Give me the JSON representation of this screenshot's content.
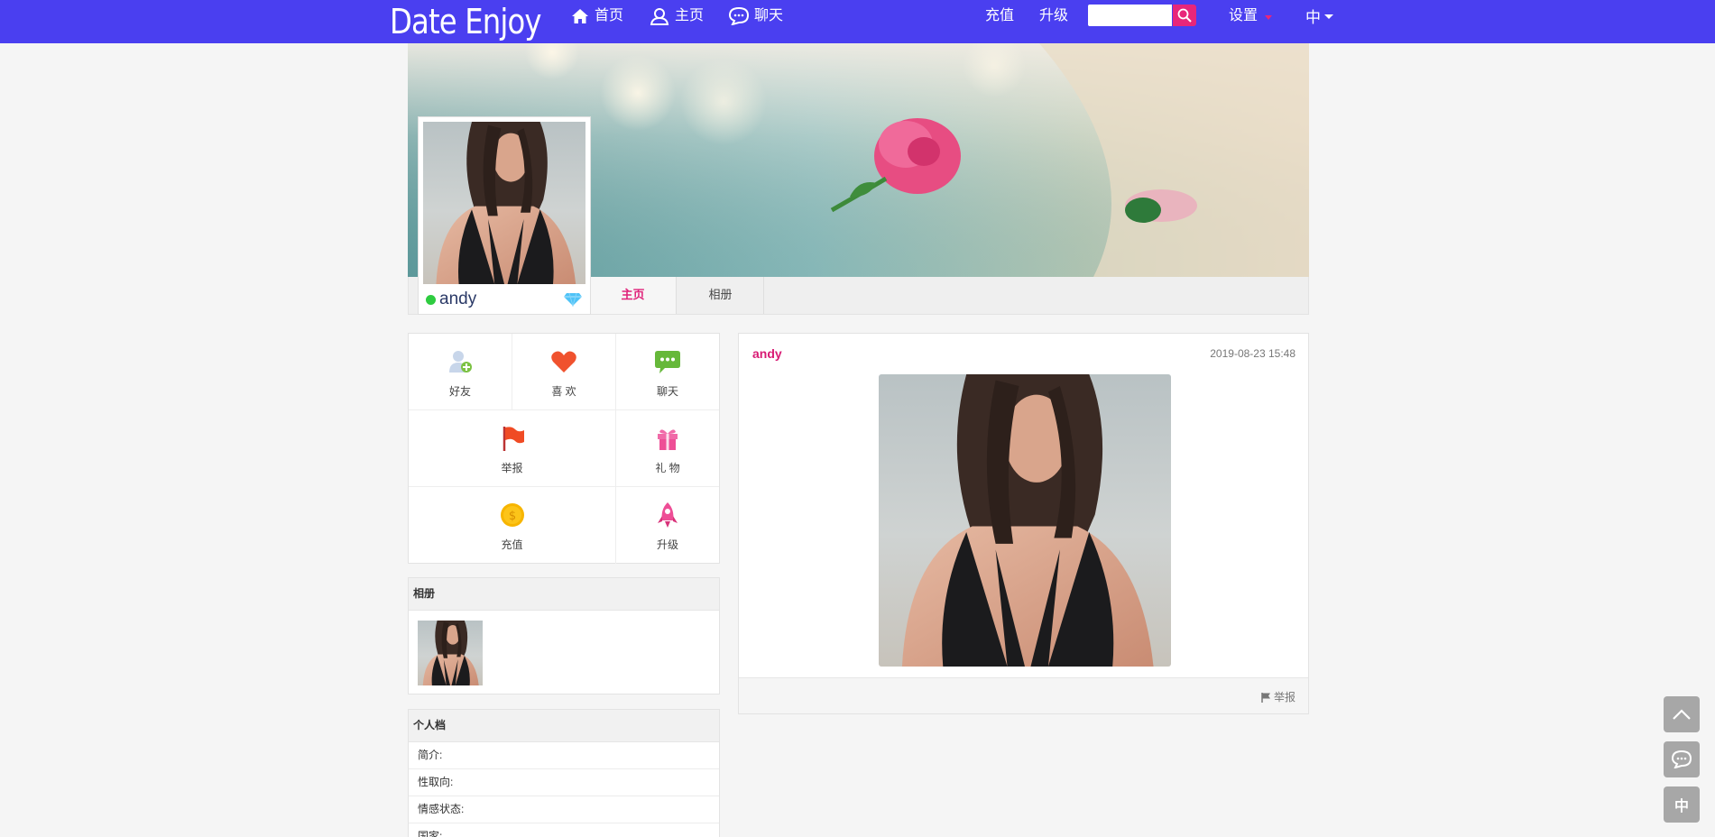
{
  "nav": {
    "brand": "Date Enjoy",
    "home": "首页",
    "main": "主页",
    "chat": "聊天",
    "recharge": "充值",
    "upgrade": "升级",
    "search_value": "",
    "settings": "设置",
    "language": "中"
  },
  "profile": {
    "username": "andy",
    "online": true
  },
  "tabs": {
    "home": "主页",
    "album": "相册"
  },
  "actions": {
    "friend": "好友",
    "like": "喜 欢",
    "chat": "聊天",
    "report": "举报",
    "gift": "礼 物",
    "recharge": "充值",
    "upgrade": "升级"
  },
  "album_panel": {
    "title": "相册"
  },
  "profile_panel": {
    "title": "个人档",
    "rows": [
      "简介:",
      "性取向:",
      "情感状态:",
      "国家:"
    ]
  },
  "post": {
    "author": "andy",
    "time": "2019-08-23 15:48",
    "report": "举报"
  },
  "float_buttons": {
    "lang": "中"
  },
  "colors": {
    "nav_bg": "#4a3ff0",
    "accent_pink": "#e0237a",
    "online": "#2ecc40"
  }
}
